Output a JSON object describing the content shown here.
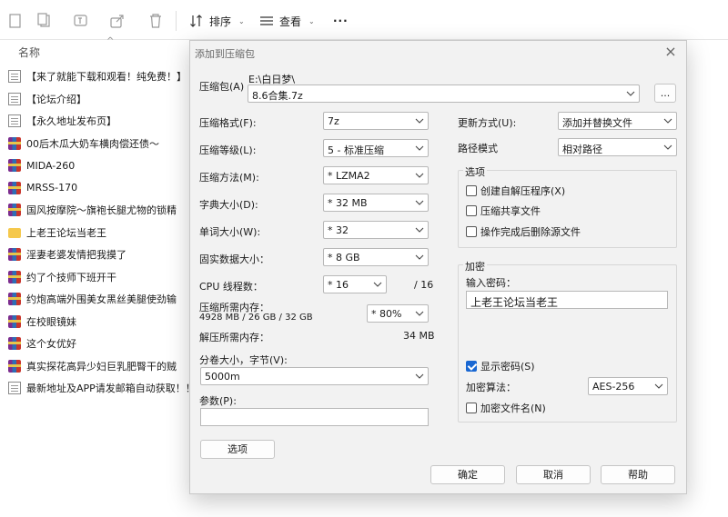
{
  "toolbar": {
    "sort_label": "排序",
    "view_label": "查看",
    "more_label": "···"
  },
  "list": {
    "col_name": "名称",
    "sort_indicator": "^",
    "files": [
      {
        "type": "doc",
        "name": "【来了就能下载和观看！纯免费！】"
      },
      {
        "type": "doc",
        "name": "【论坛介绍】"
      },
      {
        "type": "doc",
        "name": "【永久地址发布页】"
      },
      {
        "type": "rar",
        "name": "00后木瓜大奶车横肉偿还债～"
      },
      {
        "type": "rar",
        "name": "MIDA-260"
      },
      {
        "type": "rar",
        "name": "MRSS-170"
      },
      {
        "type": "rar",
        "name": "国风按摩院～旗袍长腿尤物的锁精"
      },
      {
        "type": "folder",
        "name": "上老王论坛当老王"
      },
      {
        "type": "rar",
        "name": "淫妻老婆发情把我摸了"
      },
      {
        "type": "rar",
        "name": "约了个技师下班开干"
      },
      {
        "type": "rar",
        "name": "约炮高端外围美女黑丝美腿使劲输"
      },
      {
        "type": "rar",
        "name": "在校眼镜妹"
      },
      {
        "type": "rar",
        "name": "这个女优好"
      },
      {
        "type": "rar",
        "name": "真实探花高异少妇巨乳肥臀干的贼"
      },
      {
        "type": "doc",
        "name": "最新地址及APP请发邮箱自动获取！！！"
      }
    ]
  },
  "dialog": {
    "title": "添加到压缩包",
    "archive_label": "压缩包(A)",
    "archive_path": "E:\\白日梦\\",
    "archive_name": "8.6合集.7z",
    "browse_label": "...",
    "format_label": "压缩格式(F):",
    "format_value": "7z",
    "level_label": "压缩等级(L):",
    "level_value": "5 - 标准压缩",
    "method_label": "压缩方法(M):",
    "method_value": "* LZMA2",
    "dict_label": "字典大小(D):",
    "dict_value": "* 32 MB",
    "word_label": "单词大小(W):",
    "word_value": "* 32",
    "solid_label": "固实数据大小：",
    "solid_value": "* 8 GB",
    "cpu_label": "CPU 线程数：",
    "cpu_value": "* 16",
    "cpu_max": "/ 16",
    "mem_comp_label": "压缩所需内存：",
    "mem_comp_value": "4928 MB / 26 GB / 32 GB",
    "mem_comp_pct": "* 80%",
    "mem_decomp_label": "解压所需内存：",
    "mem_decomp_value": "34 MB",
    "split_label": "分卷大小，字节(V):",
    "split_value": "5000m",
    "params_label": "参数(P):",
    "params_value": "",
    "options_button": "选项",
    "update_label": "更新方式(U):",
    "update_value": "添加并替换文件",
    "path_label": "路径模式",
    "path_value": "相对路径",
    "options_group": "选项",
    "opt_sfx": "创建自解压程序(X)",
    "opt_shared": "压缩共享文件",
    "opt_delete": "操作完成后删除源文件",
    "encrypt_group": "加密",
    "password_label": "输入密码：",
    "password_value": "上老王论坛当老王",
    "show_password": "显示密码(S)",
    "enc_method_label": "加密算法：",
    "enc_method_value": "AES-256",
    "encrypt_names": "加密文件名(N)",
    "ok": "确定",
    "cancel": "取消",
    "help": "帮助"
  }
}
